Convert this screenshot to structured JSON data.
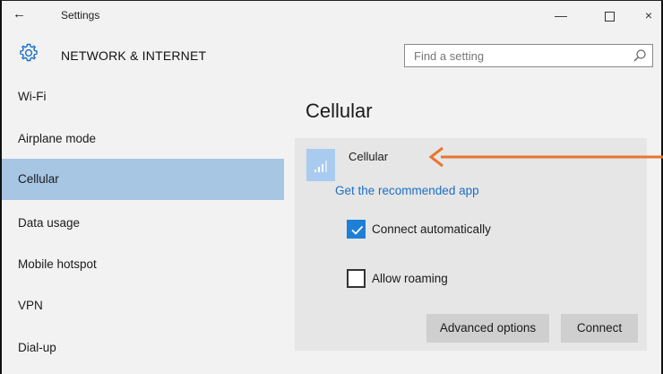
{
  "window": {
    "title": "Settings",
    "back_glyph": "←",
    "minimize_glyph": "—",
    "close_glyph": "×"
  },
  "header": {
    "title": "NETWORK & INTERNET",
    "icon": "gear-icon"
  },
  "search": {
    "placeholder": "Find a setting",
    "icon": "search-icon"
  },
  "sidebar": {
    "items": [
      {
        "label": "Wi-Fi"
      },
      {
        "label": "Airplane mode"
      },
      {
        "label": "Cellular"
      },
      {
        "label": "Data usage"
      },
      {
        "label": "Mobile hotspot"
      },
      {
        "label": "VPN"
      },
      {
        "label": "Dial-up"
      }
    ],
    "active_index": 2
  },
  "main": {
    "title": "Cellular",
    "card": {
      "icon": "cellular-signal-icon",
      "name": "Cellular",
      "link": "Get the recommended app",
      "checkboxes": [
        {
          "label": "Connect automatically",
          "checked": true
        },
        {
          "label": "Allow roaming",
          "checked": false
        }
      ],
      "buttons": {
        "advanced": "Advanced options",
        "connect": "Connect"
      }
    }
  },
  "colors": {
    "active_nav": "#a7c6e3",
    "accent": "#1e7fd6",
    "link": "#1a6fc6",
    "tile": "#a9cbf0",
    "annotation_arrow": "#e8772e"
  }
}
